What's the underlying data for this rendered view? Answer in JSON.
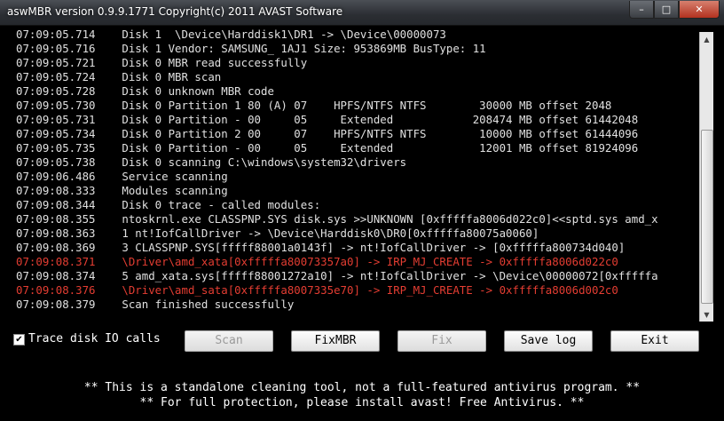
{
  "window": {
    "title": "aswMBR version 0.9.9.1771 Copyright(c) 2011 AVAST Software",
    "minimize_glyph": "–",
    "maximize_glyph": "□",
    "close_glyph": "✕"
  },
  "log": [
    {
      "text": "07:09:05.714    Disk 1  \\Device\\Harddisk1\\DR1 -> \\Device\\00000073",
      "error": false
    },
    {
      "text": "07:09:05.716    Disk 1 Vendor: SAMSUNG_ 1AJ1 Size: 953869MB BusType: 11",
      "error": false
    },
    {
      "text": "07:09:05.721    Disk 0 MBR read successfully",
      "error": false
    },
    {
      "text": "07:09:05.724    Disk 0 MBR scan",
      "error": false
    },
    {
      "text": "07:09:05.728    Disk 0 unknown MBR code",
      "error": false
    },
    {
      "text": "07:09:05.730    Disk 0 Partition 1 80 (A) 07    HPFS/NTFS NTFS        30000 MB offset 2048",
      "error": false
    },
    {
      "text": "07:09:05.731    Disk 0 Partition - 00     05     Extended            208474 MB offset 61442048",
      "error": false
    },
    {
      "text": "07:09:05.734    Disk 0 Partition 2 00     07    HPFS/NTFS NTFS        10000 MB offset 61444096",
      "error": false
    },
    {
      "text": "07:09:05.735    Disk 0 Partition - 00     05     Extended             12001 MB offset 81924096",
      "error": false
    },
    {
      "text": "07:09:05.738    Disk 0 scanning C:\\windows\\system32\\drivers",
      "error": false
    },
    {
      "text": "07:09:06.486    Service scanning",
      "error": false
    },
    {
      "text": "07:09:08.333    Modules scanning",
      "error": false
    },
    {
      "text": "07:09:08.344    Disk 0 trace - called modules:",
      "error": false
    },
    {
      "text": "07:09:08.355    ntoskrnl.exe CLASSPNP.SYS disk.sys >>UNKNOWN [0xfffffa8006d022c0]<<sptd.sys amd_x",
      "error": false
    },
    {
      "text": "07:09:08.363    1 nt!IofCallDriver -> \\Device\\Harddisk0\\DR0[0xfffffa80075a0060]",
      "error": false
    },
    {
      "text": "07:09:08.369    3 CLASSPNP.SYS[fffff88001a0143f] -> nt!IofCallDriver -> [0xfffffa800734d040]",
      "error": false
    },
    {
      "text": "07:09:08.371    \\Driver\\amd_xata[0xfffffa80073357a0] -> IRP_MJ_CREATE -> 0xfffffa8006d022c0",
      "error": true
    },
    {
      "text": "07:09:08.374    5 amd_xata.sys[fffff88001272a10] -> nt!IofCallDriver -> \\Device\\00000072[0xfffffa",
      "error": false
    },
    {
      "text": "07:09:08.376    \\Driver\\amd_sata[0xfffffa8007335e70] -> IRP_MJ_CREATE -> 0xfffffa8006d002c0",
      "error": true
    },
    {
      "text": "07:09:08.379    Scan finished successfully",
      "error": false
    }
  ],
  "controls": {
    "trace_checkbox": {
      "label": "Trace disk IO calls",
      "checked": true,
      "mark": "✔"
    },
    "scan_label": "Scan",
    "fixmbr_label": "FixMBR",
    "fix_label": "Fix",
    "savelog_label": "Save log",
    "exit_label": "Exit"
  },
  "footer": {
    "line1": "** This is a standalone cleaning tool, not a full-featured antivirus program. **",
    "line2": "** For full protection, please install avast! Free Antivirus. **"
  },
  "scrollbar": {
    "up_glyph": "▲",
    "down_glyph": "▼"
  },
  "colors": {
    "background": "#000000",
    "text": "#e0e0e0",
    "error": "#e43d32"
  }
}
